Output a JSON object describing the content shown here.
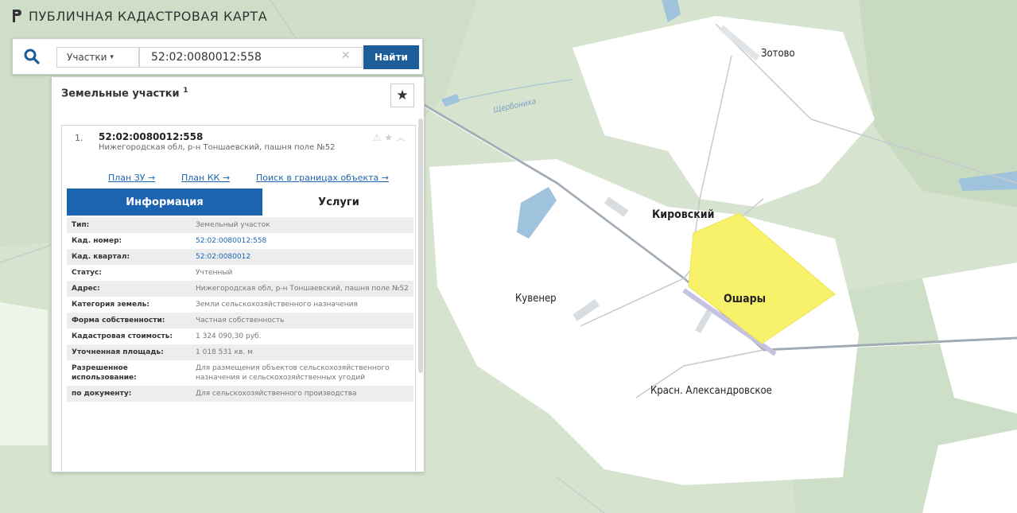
{
  "app": {
    "title": "ПУБЛИЧНАЯ КАДАСТРОВАЯ КАРТА"
  },
  "search": {
    "type_label": "Участки",
    "query": "52:02:0080012:558",
    "button_label": "Найти"
  },
  "panel": {
    "title": "Земельные участки",
    "count": "1",
    "result": {
      "index": "1.",
      "number": "52:02:0080012:558",
      "address": "Нижегородская обл, р-н Тоншаевский, пашня поле №52",
      "links": [
        "План ЗУ →",
        "План КК →",
        "Поиск в границах объекта →"
      ]
    },
    "tabs": {
      "info": "Информация",
      "services": "Услуги"
    },
    "fields": [
      {
        "label": "Тип:",
        "value": "Земельный участок"
      },
      {
        "label": "Кад. номер:",
        "value": "52:02:0080012:558"
      },
      {
        "label": "Кад. квартал:",
        "value": "52:02:0080012"
      },
      {
        "label": "Статус:",
        "value": "Учтенный"
      },
      {
        "label": "Адрес:",
        "value": "Нижегородская обл, р-н Тоншаевский, пашня поле №52"
      },
      {
        "label": "Категория земель:",
        "value": "Земли сельскохозяйственного назначения"
      },
      {
        "label": "Форма собственности:",
        "value": "Частная собственность"
      },
      {
        "label": "Кадастровая стоимость:",
        "value": "1 324 090,30 руб."
      },
      {
        "label": "Уточненная площадь:",
        "value": "1 018 531 кв. м"
      },
      {
        "label": "Разрешенное использование:",
        "value": "Для размещения объектов сельскохозяйственного назначения и сельскохозяйственных угодий"
      },
      {
        "label": "по документу:",
        "value": "Для сельскохозяйственного производства"
      }
    ]
  },
  "map": {
    "places": [
      "Зотово",
      "Кировский",
      "Ошары",
      "Кувенер",
      "Красн. Александровское"
    ],
    "river": "Щербониха",
    "colors": {
      "parcel": "#f7f26a",
      "forest": "#c7dbbf",
      "clearing": "#ffffff",
      "water": "#9fc3dc",
      "road": "#9aa3ad"
    }
  }
}
